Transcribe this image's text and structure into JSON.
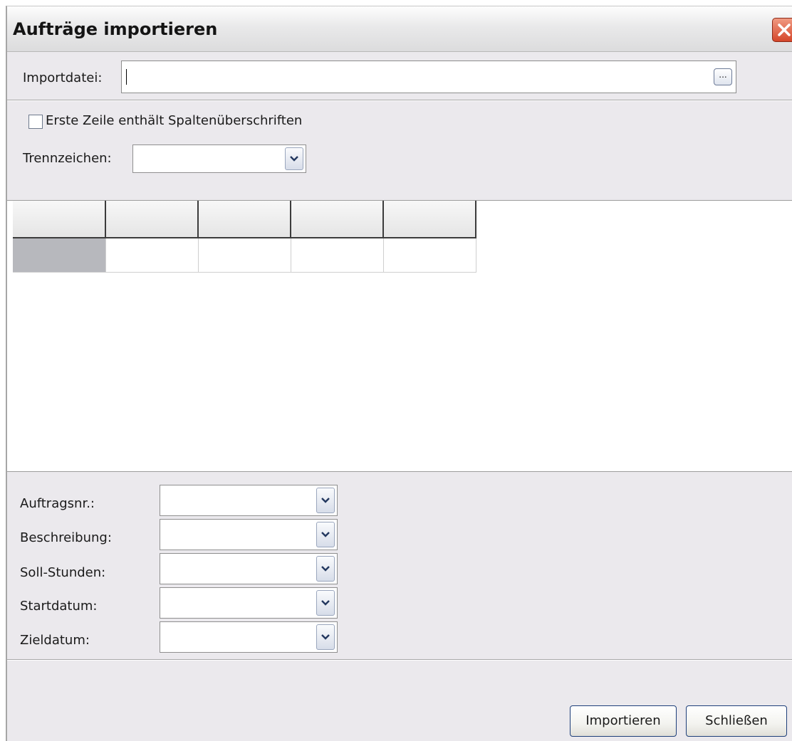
{
  "window": {
    "title": "Aufträge importieren"
  },
  "import": {
    "label": "Importdatei:",
    "value": "",
    "browse_label": "..."
  },
  "options": {
    "header_checkbox_label": "Erste Zeile enthält Spaltenüberschriften",
    "header_checkbox_checked": false,
    "delimiter_label": "Trennzeichen:",
    "delimiter_value": ""
  },
  "preview_grid": {
    "headers": [
      "",
      "",
      "",
      "",
      ""
    ],
    "rows": [
      [
        "",
        "",
        "",
        "",
        ""
      ]
    ]
  },
  "mapping": {
    "fields": [
      {
        "label": "Auftragsnr.:",
        "value": ""
      },
      {
        "label": "Beschreibung:",
        "value": ""
      },
      {
        "label": "Soll-Stunden:",
        "value": ""
      },
      {
        "label": "Startdatum:",
        "value": ""
      },
      {
        "label": "Zieldatum:",
        "value": ""
      }
    ]
  },
  "buttons": {
    "import_label": "Importieren",
    "close_label": "Schließen"
  },
  "colors": {
    "close_button": "#d5462a",
    "button_border": "#1e3f7a",
    "dialog_background": "#ebe9ed"
  }
}
